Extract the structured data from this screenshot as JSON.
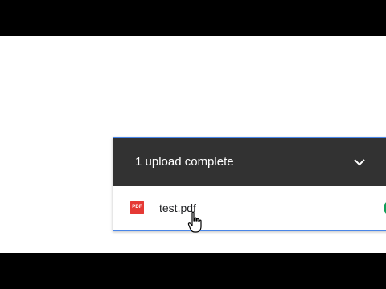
{
  "upload_panel": {
    "title": "1 upload complete",
    "collapse_icon": "chevron-down-icon",
    "header_color": "#323232",
    "border_color": "#4a86e8",
    "items": [
      {
        "file_icon": "pdf-file-icon",
        "file_icon_text": "PDF",
        "file_name": "test.pdf",
        "status_icon": "complete-check-icon",
        "status_color": "#0f9d58",
        "icon_color": "#e53935"
      }
    ]
  },
  "cursor": "hand-pointer-icon"
}
